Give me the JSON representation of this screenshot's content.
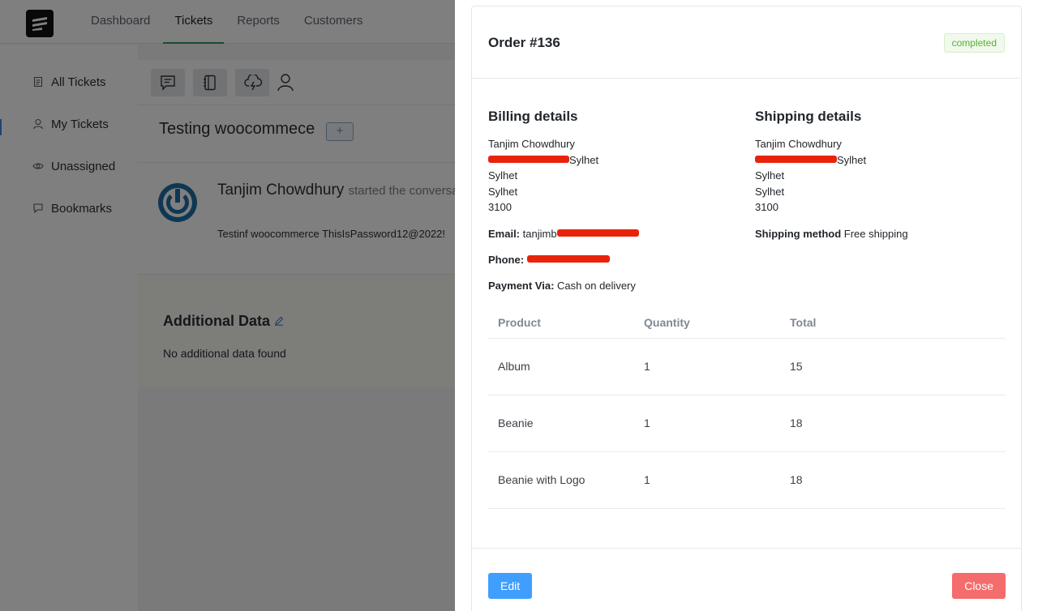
{
  "topnav": {
    "items": [
      {
        "label": "Dashboard"
      },
      {
        "label": "Tickets",
        "active": true
      },
      {
        "label": "Reports"
      },
      {
        "label": "Customers"
      }
    ]
  },
  "sidebar": {
    "items": [
      {
        "label": "All Tickets",
        "icon": "document-icon"
      },
      {
        "label": "My Tickets",
        "icon": "user-icon"
      },
      {
        "label": "Unassigned",
        "icon": "eye-icon"
      },
      {
        "label": "Bookmarks",
        "icon": "bookmark-icon"
      }
    ]
  },
  "ticket": {
    "title": "Testing woocommece",
    "add_symbol": "+",
    "conversation": {
      "author": "Tanjim Chowdhury",
      "action": "started the conversa",
      "body": "Testinf woocommerce ThisIsPassword12@2022!"
    },
    "additional": {
      "title": "Additional Data",
      "empty_text": "No additional data found"
    }
  },
  "order": {
    "title": "Order #136",
    "status": "completed",
    "billing": {
      "heading": "Billing details",
      "name": "Tanjim Chowdhury",
      "line2_visible": "Sylhet",
      "city": "Sylhet",
      "state": "Sylhet",
      "postcode": "3100",
      "email_label": "Email:",
      "email_visible": "tanjimb",
      "phone_label": "Phone:",
      "payment_label": "Payment Via:",
      "payment_value": "Cash on delivery"
    },
    "shipping": {
      "heading": "Shipping details",
      "name": "Tanjim Chowdhury",
      "line2_visible": "Sylhet",
      "city": "Sylhet",
      "state": "Sylhet",
      "postcode": "3100",
      "method_label": "Shipping method",
      "method_value": "Free shipping"
    },
    "table": {
      "headers": [
        "Product",
        "Quantity",
        "Total"
      ],
      "rows": [
        {
          "product": "Album",
          "quantity": "1",
          "total": "15"
        },
        {
          "product": "Beanie",
          "quantity": "1",
          "total": "18"
        },
        {
          "product": "Beanie with Logo",
          "quantity": "1",
          "total": "18"
        }
      ]
    },
    "buttons": {
      "edit": "Edit",
      "close": "Close"
    }
  },
  "colors": {
    "accent_green": "#2e9e5b",
    "edit_blue": "#409eff",
    "close_red": "#f56c6c",
    "redaction_red": "#e8230b",
    "status_green": "#58ae3a"
  }
}
